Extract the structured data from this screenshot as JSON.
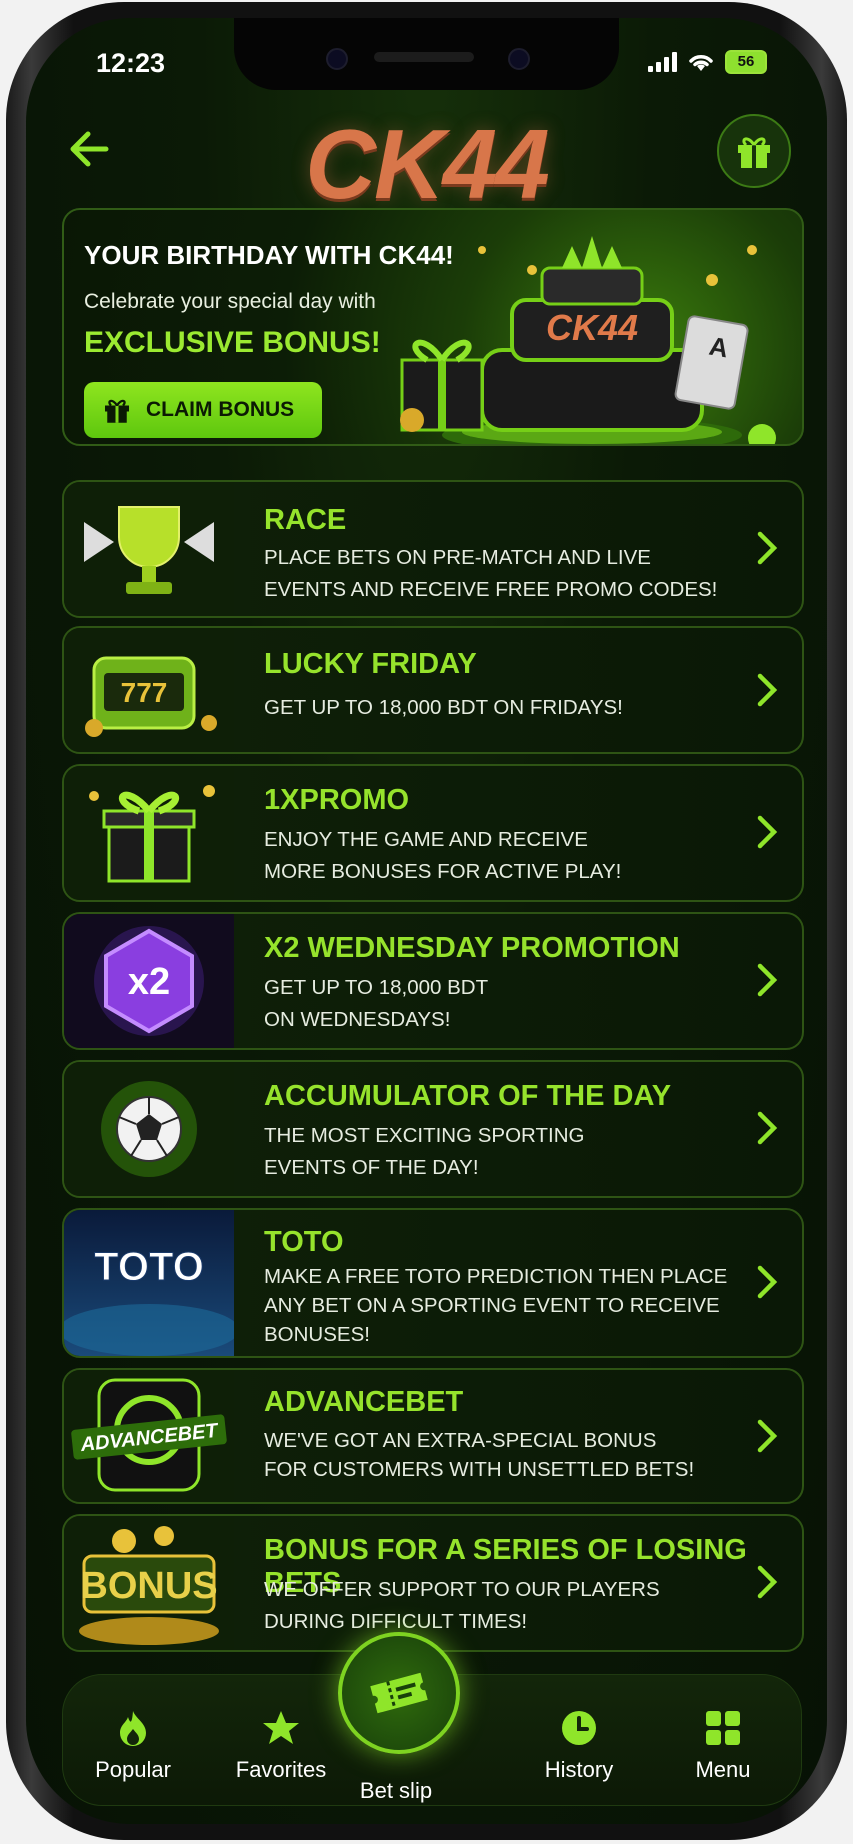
{
  "status_bar": {
    "time": "12:23",
    "battery": "56"
  },
  "header": {
    "logo": "CK44"
  },
  "hero": {
    "title": "YOUR BIRTHDAY WITH CK44!",
    "subtitle": "Celebrate your special day with",
    "bonus": "EXCLUSIVE BONUS!",
    "button": "CLAIM BONUS",
    "cake_text": "CK44"
  },
  "promos": [
    {
      "title": "RACE",
      "line1": "PLACE BETS ON PRE-MATCH AND LIVE",
      "line2": "EVENTS AND RECEIVE FREE PROMO CODES!",
      "line3": "",
      "icon": "trophy-icon"
    },
    {
      "title": "LUCKY FRIDAY",
      "line1": "GET UP TO 18,000 BDT ON FRIDAYS!",
      "line2": "",
      "line3": "",
      "icon": "slot-machine-icon",
      "slot_text": "777"
    },
    {
      "title": "1XPROMO",
      "line1": "ENJOY THE GAME AND RECEIVE",
      "line2": "MORE BONUSES FOR ACTIVE PLAY!",
      "line3": "",
      "icon": "gift-box-icon"
    },
    {
      "title": "X2 WEDNESDAY PROMOTION",
      "line1": "GET UP TO 18,000 BDT",
      "line2": "ON WEDNESDAYS!",
      "line3": "",
      "icon": "x2-badge-icon",
      "badge_text": "x2"
    },
    {
      "title": "ACCUMULATOR OF THE DAY",
      "line1": "THE MOST EXCITING SPORTING",
      "line2": "EVENTS OF THE DAY!",
      "line3": "",
      "icon": "soccer-ball-icon"
    },
    {
      "title": "TOTO",
      "line1": "MAKE A FREE TOTO PREDICTION THEN PLACE",
      "line2": "ANY BET ON A SPORTING EVENT TO RECEIVE",
      "line3": "BONUSES!",
      "icon": "toto-icon",
      "badge_text": "TOTO"
    },
    {
      "title": "ADVANCEBET",
      "line1": "WE'VE GOT AN EXTRA-SPECIAL BONUS",
      "line2": "FOR CUSTOMERS WITH UNSETTLED BETS!",
      "line3": "",
      "icon": "advancebet-icon",
      "badge_text": "ADVANCEBET"
    },
    {
      "title": "BONUS FOR A SERIES OF LOSING BETS",
      "line1": "WE OFFER SUPPORT TO OUR PLAYERS",
      "line2": "DURING DIFFICULT TIMES!",
      "line3": "",
      "icon": "bonus-coins-icon",
      "badge_text": "BONUS"
    }
  ],
  "bottom_nav": {
    "popular": "Popular",
    "favorites": "Favorites",
    "betslip": "Bet slip",
    "history": "History",
    "menu": "Menu"
  },
  "colors": {
    "accent": "#96e32c",
    "logo": "#d8764a",
    "background": "#0b1a06"
  }
}
